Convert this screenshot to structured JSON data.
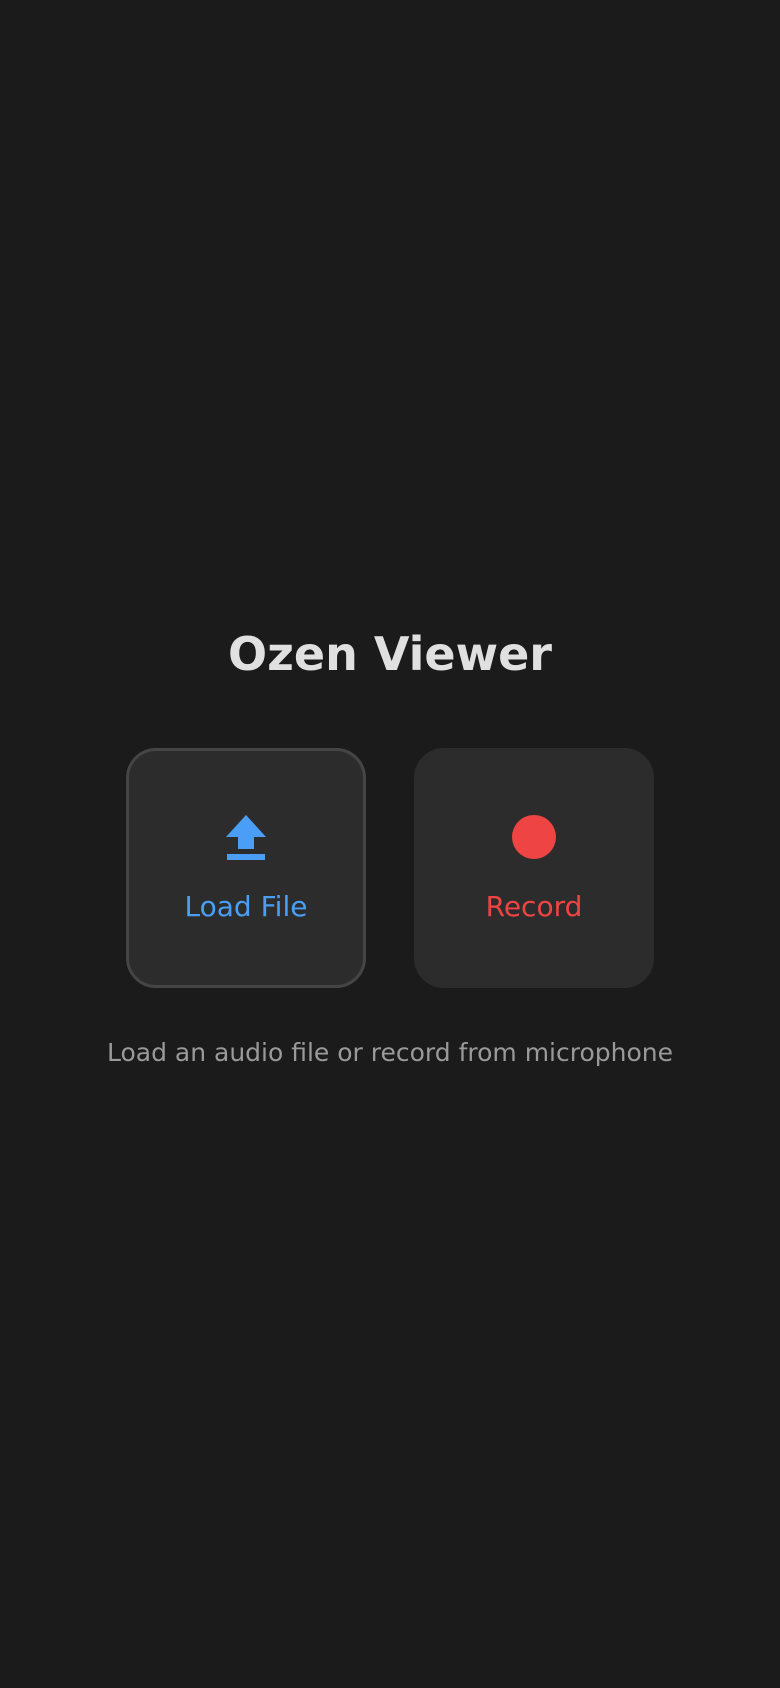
{
  "app": {
    "title": "Ozen Viewer"
  },
  "actions": {
    "load_file": {
      "label": "Load File",
      "icon": "upload-icon",
      "color": "#4a9ef5"
    },
    "record": {
      "label": "Record",
      "icon": "record-icon",
      "color": "#ef4444"
    }
  },
  "hint": "Load an audio file or record from microphone",
  "colors": {
    "background": "#1b1b1b",
    "card": "#2c2c2c",
    "card_border_focused": "#454545",
    "title": "#e0e0e0",
    "hint": "#9a9a9a"
  }
}
